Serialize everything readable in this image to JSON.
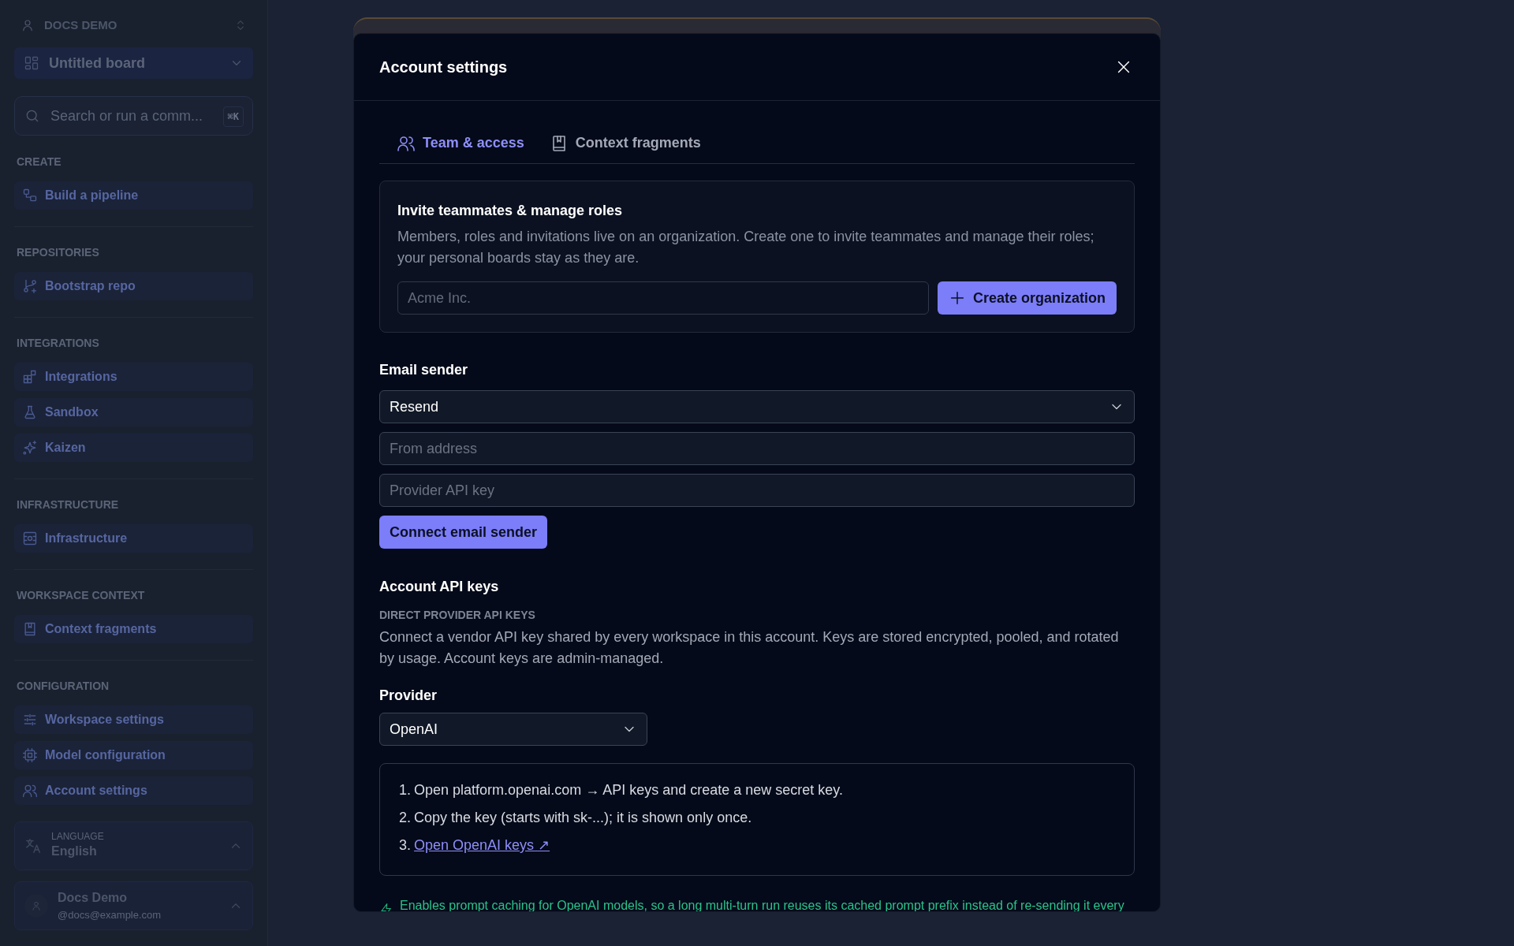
{
  "sidebar": {
    "workspace": "DOCS DEMO",
    "board": "Untitled board",
    "search": {
      "placeholder": "Search or run a comm...",
      "shortcut": "⌘K"
    },
    "sections": [
      {
        "title": "CREATE",
        "items": [
          {
            "label": "Build a pipeline",
            "kind": "pipeline"
          }
        ]
      },
      {
        "title": "REPOSITORIES",
        "items": [
          {
            "label": "Bootstrap repo",
            "kind": "branch"
          }
        ]
      },
      {
        "title": "INTEGRATIONS",
        "items": [
          {
            "label": "Integrations",
            "kind": "blocks"
          },
          {
            "label": "Sandbox",
            "kind": "flask"
          },
          {
            "label": "Kaizen",
            "kind": "sparkle"
          }
        ]
      },
      {
        "title": "INFRASTRUCTURE",
        "items": [
          {
            "label": "Infrastructure",
            "kind": "server"
          }
        ]
      },
      {
        "title": "WORKSPACE CONTEXT",
        "items": [
          {
            "label": "Context fragments",
            "kind": "book"
          }
        ]
      },
      {
        "title": "CONFIGURATION",
        "items": [
          {
            "label": "Workspace settings",
            "kind": "sliders"
          },
          {
            "label": "Model configuration",
            "kind": "chip"
          },
          {
            "label": "Account settings",
            "kind": "users"
          }
        ]
      }
    ],
    "language": {
      "label": "LANGUAGE",
      "value": "English"
    },
    "user": {
      "name": "Docs Demo",
      "email": "@docs@example.com"
    }
  },
  "modal": {
    "title": "Account settings",
    "tabs": [
      {
        "label": "Team & access",
        "kind": "users",
        "selected": true
      },
      {
        "label": "Context fragments",
        "kind": "book",
        "selected": false
      }
    ],
    "invite": {
      "title": "Invite teammates & manage roles",
      "text": "Members, roles and invitations live on an organization. Create one to invite teammates and manage their roles; your personal boards stay as they are.",
      "placeholder": "Acme Inc.",
      "button": "Create organization"
    },
    "email_sender": {
      "title": "Email sender",
      "provider": "Resend",
      "from_placeholder": "From address",
      "key_placeholder": "Provider API key",
      "button": "Connect email sender"
    },
    "api_keys": {
      "title": "Account API keys",
      "subtitle": "DIRECT PROVIDER API KEYS",
      "text": "Connect a vendor API key shared by every workspace in this account. Keys are stored encrypted, pooled, and rotated by usage. Account keys are admin-managed.",
      "provider_label": "Provider",
      "provider": "OpenAI",
      "steps": [
        {
          "number": "1.",
          "kind": "text",
          "text": "Open platform.openai.com → API keys and create a new secret key."
        },
        {
          "number": "2.",
          "kind": "text",
          "text": "Copy the key (starts with sk-...); it is shown only once."
        },
        {
          "number": "3.",
          "kind": "link",
          "text": "Open OpenAI keys ↗"
        }
      ]
    },
    "note": "Enables prompt caching for OpenAI models, so a long multi-turn run reuses its cached prompt prefix instead of re-sending it every"
  }
}
